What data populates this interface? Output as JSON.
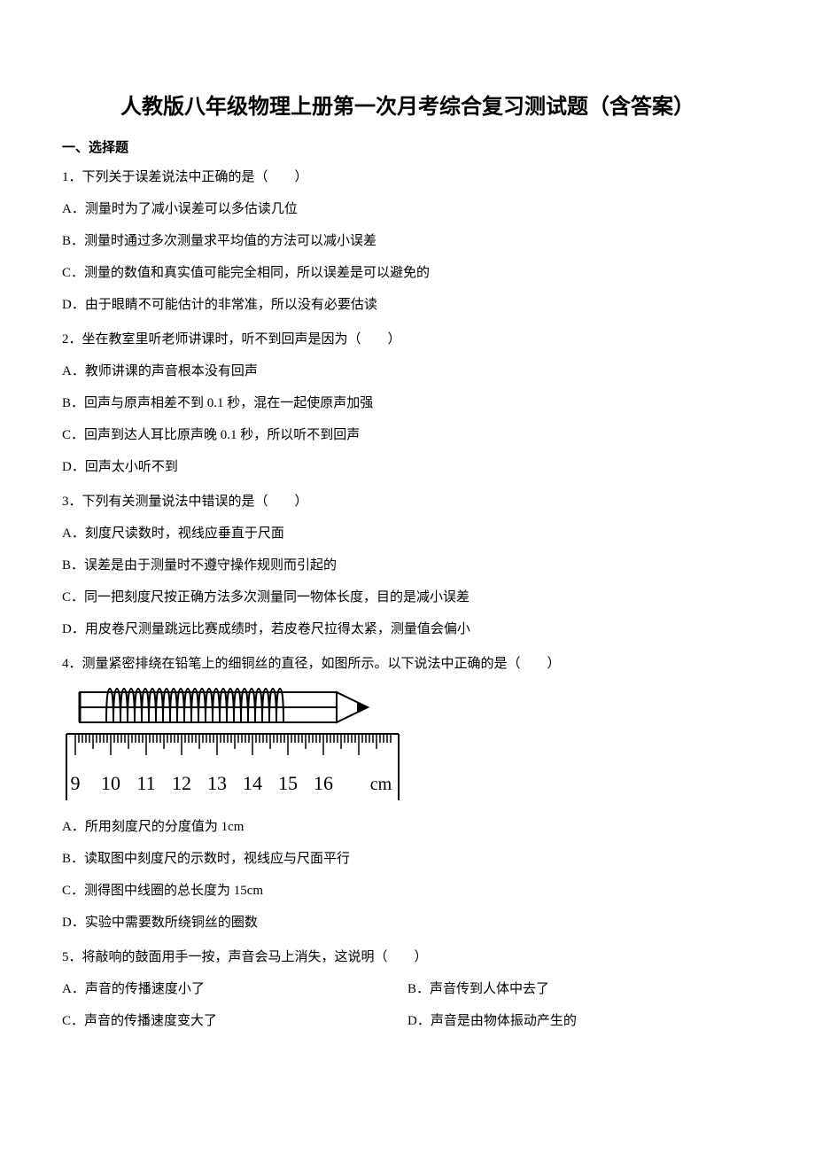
{
  "title": "人教版八年级物理上册第一次月考综合复习测试题（含答案）",
  "section": "一、选择题",
  "q1": {
    "stem": "1．下列关于误差说法中正确的是（　　）",
    "a": "A．测量时为了减小误差可以多估读几位",
    "b": "B．测量时通过多次测量求平均值的方法可以减小误差",
    "c": "C．测量的数值和真实值可能完全相同，所以误差是可以避免的",
    "d": "D．由于眼睛不可能估计的非常准，所以没有必要估读"
  },
  "q2": {
    "stem": "2．坐在教室里听老师讲课时，听不到回声是因为（　　）",
    "a": "A．教师讲课的声音根本没有回声",
    "b": "B．回声与原声相差不到 0.1 秒，混在一起使原声加强",
    "c": "C．回声到达人耳比原声晚 0.1 秒，所以听不到回声",
    "d": "D．回声太小听不到"
  },
  "q3": {
    "stem": "3．下列有关测量说法中错误的是（　　）",
    "a": "A．刻度尺读数时，视线应垂直于尺面",
    "b": "B．误差是由于测量时不遵守操作规则而引起的",
    "c": "C．同一把刻度尺按正确方法多次测量同一物体长度，目的是减小误差",
    "d": "D．用皮卷尺测量跳远比赛成绩时，若皮卷尺拉得太紧，测量值会偏小"
  },
  "q4": {
    "stem": "4．测量紧密排绕在铅笔上的细铜丝的直径，如图所示。以下说法中正确的是（　　）",
    "a": "A．所用刻度尺的分度值为 1cm",
    "b": "B．读取图中刻度尺的示数时，视线应与尺面平行",
    "c": "C．测得图中线圈的总长度为 15cm",
    "d": "D．实验中需要数所绕铜丝的圈数"
  },
  "q5": {
    "stem": "5．将敲响的鼓面用手一按，声音会马上消失，这说明（　　）",
    "a": "A．声音的传播速度小了",
    "b": "B．声音传到人体中去了",
    "c": "C．声音的传播速度变大了",
    "d": "D．声音是由物体振动产生的"
  },
  "ruler": {
    "unit": "cm",
    "labels": [
      "9",
      "10",
      "11",
      "12",
      "13",
      "14",
      "15",
      "16"
    ]
  }
}
